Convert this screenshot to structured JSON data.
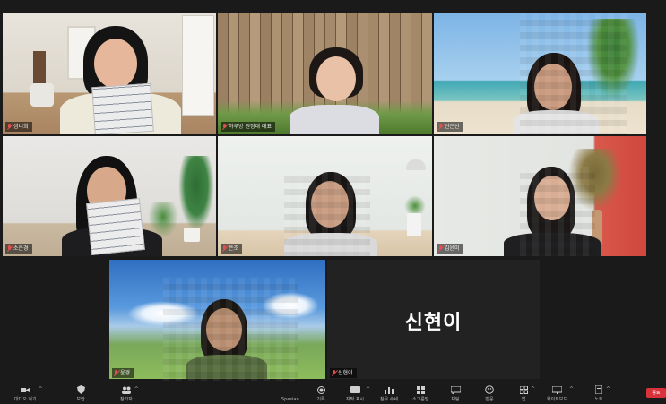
{
  "participants": [
    {
      "name": "섬니희",
      "position": "top-left"
    },
    {
      "name": "하루방 원정대 대표",
      "position": "top-center"
    },
    {
      "name": "신은선",
      "position": "top-right"
    },
    {
      "name": "소은경",
      "position": "middle-left"
    },
    {
      "name": "은조",
      "position": "middle-center"
    },
    {
      "name": "김윤미",
      "position": "middle-right"
    },
    {
      "name": "윤경",
      "position": "bottom-left"
    },
    {
      "name": "신현이",
      "position": "bottom-center"
    }
  ],
  "audio_only_display_name": "신현이",
  "toolbar": {
    "items": [
      {
        "label": "대디오 켜기",
        "icon": "mic-icon"
      },
      {
        "label": "보안",
        "icon": "shield-icon"
      },
      {
        "label": "참가자",
        "icon": "participants-icon"
      },
      {
        "label": "Spesian",
        "icon": "dot-icon"
      },
      {
        "label": "기록",
        "icon": "record-icon"
      },
      {
        "label": "자막 표시",
        "icon": "cc-icon"
      },
      {
        "label": "참우 수세",
        "icon": "chart-icon"
      },
      {
        "label": "소그룹방",
        "icon": "grid-icon"
      },
      {
        "label": "채팅",
        "icon": "chat-icon"
      },
      {
        "label": "반응",
        "icon": "reaction-icon"
      },
      {
        "label": "앱",
        "icon": "apps-icon"
      },
      {
        "label": "화이트보드",
        "icon": "whiteboard-icon"
      },
      {
        "label": "노트",
        "icon": "notes-icon"
      },
      {
        "label": "종료",
        "icon": "end-button"
      }
    ]
  },
  "colors": {
    "background": "#1a1a1a",
    "speaker_outline": "#c9d94a",
    "end_button": "#d8333b",
    "muted_mic": "#e05050"
  }
}
